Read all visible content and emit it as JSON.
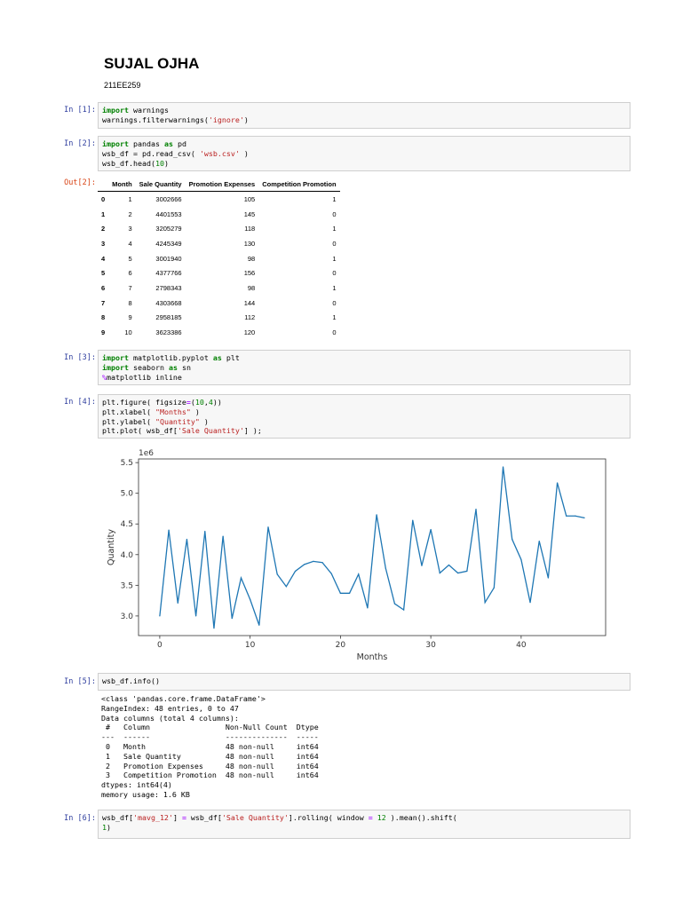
{
  "title": "SUJAL OJHA",
  "subtitle": "211EE259",
  "cells": [
    {
      "prompt": "In [1]:",
      "lines": [
        [
          [
            "import",
            "kw"
          ],
          [
            " warnings",
            ""
          ]
        ],
        [
          [
            "warnings.filterwarnings(",
            ""
          ],
          [
            "'ignore'",
            "str"
          ],
          [
            ")",
            ""
          ]
        ]
      ]
    },
    {
      "prompt": "In [2]:",
      "lines": [
        [
          [
            "import",
            "kw"
          ],
          [
            " pandas ",
            ""
          ],
          [
            "as",
            "kw"
          ],
          [
            " pd",
            ""
          ]
        ],
        [
          [
            "wsb_df = pd.read_csv( ",
            ""
          ],
          [
            "'wsb.csv'",
            "str"
          ],
          [
            " )",
            ""
          ]
        ],
        [
          [
            "wsb_df.head(",
            ""
          ],
          [
            "10",
            "num"
          ],
          [
            ")",
            ""
          ]
        ]
      ]
    },
    {
      "prompt": "In [3]:",
      "lines": [
        [
          [
            "import",
            "kw"
          ],
          [
            " matplotlib.pyplot ",
            ""
          ],
          [
            "as",
            "kw"
          ],
          [
            " plt",
            ""
          ]
        ],
        [
          [
            "import",
            "kw"
          ],
          [
            " seaborn ",
            ""
          ],
          [
            "as",
            "kw"
          ],
          [
            " sn",
            ""
          ]
        ],
        [
          [
            "%",
            "mag"
          ],
          [
            "matplotlib inline",
            ""
          ]
        ]
      ]
    },
    {
      "prompt": "In [4]:",
      "lines": [
        [
          [
            "plt.figure( figsize",
            ""
          ],
          [
            "=",
            "mag"
          ],
          [
            "(",
            ""
          ],
          [
            "10",
            "num"
          ],
          [
            ",",
            ""
          ],
          [
            "4",
            "num"
          ],
          [
            "))",
            ""
          ]
        ],
        [
          [
            "plt.xlabel( ",
            ""
          ],
          [
            "\"Months\"",
            "str"
          ],
          [
            " )",
            ""
          ]
        ],
        [
          [
            "plt.ylabel( ",
            ""
          ],
          [
            "\"Quantity\"",
            "str"
          ],
          [
            " )",
            ""
          ]
        ],
        [
          [
            "plt.plot( wsb_df[",
            ""
          ],
          [
            "'Sale Quantity'",
            "str"
          ],
          [
            "] );",
            ""
          ]
        ]
      ]
    },
    {
      "prompt": "In [5]:",
      "lines": [
        [
          [
            "wsb_df.info()",
            ""
          ]
        ]
      ]
    },
    {
      "prompt": "In [6]:",
      "lines": [
        [
          [
            "wsb_df[",
            ""
          ],
          [
            "'mavg_12'",
            "str"
          ],
          [
            "] ",
            ""
          ],
          [
            "=",
            "mag"
          ],
          [
            " wsb_df[",
            ""
          ],
          [
            "'Sale Quantity'",
            "str"
          ],
          [
            "].rolling( window ",
            ""
          ],
          [
            "=",
            "mag"
          ],
          [
            " ",
            ""
          ],
          [
            "12",
            "num"
          ],
          [
            " ).mean().shift(",
            ""
          ]
        ],
        [
          [
            "1",
            "num"
          ],
          [
            ")",
            ""
          ]
        ]
      ]
    }
  ],
  "out2": {
    "prompt": "Out[2]:",
    "columns": [
      "",
      "Month",
      "Sale Quantity",
      "Promotion Expenses",
      "Competition Promotion"
    ],
    "rows": [
      [
        "0",
        "1",
        "3002666",
        "105",
        "1"
      ],
      [
        "1",
        "2",
        "4401553",
        "145",
        "0"
      ],
      [
        "2",
        "3",
        "3205279",
        "118",
        "1"
      ],
      [
        "3",
        "4",
        "4245349",
        "130",
        "0"
      ],
      [
        "4",
        "5",
        "3001940",
        "98",
        "1"
      ],
      [
        "5",
        "6",
        "4377766",
        "156",
        "0"
      ],
      [
        "6",
        "7",
        "2798343",
        "98",
        "1"
      ],
      [
        "7",
        "8",
        "4303668",
        "144",
        "0"
      ],
      [
        "8",
        "9",
        "2958185",
        "112",
        "1"
      ],
      [
        "9",
        "10",
        "3623386",
        "120",
        "0"
      ]
    ]
  },
  "info_output": "<class 'pandas.core.frame.DataFrame'>\nRangeIndex: 48 entries, 0 to 47\nData columns (total 4 columns):\n #   Column                 Non-Null Count  Dtype\n---  ------                 --------------  -----\n 0   Month                  48 non-null     int64\n 1   Sale Quantity          48 non-null     int64\n 2   Promotion Expenses     48 non-null     int64\n 3   Competition Promotion  48 non-null     int64\ndtypes: int64(4)\nmemory usage: 1.6 KB",
  "chart_data": {
    "type": "line",
    "xlabel": "Months",
    "ylabel": "Quantity",
    "offset_label": "1e6",
    "xlim": [
      -2.35,
      49.35
    ],
    "ylim": [
      2.68,
      5.56
    ],
    "xticks": [
      0,
      10,
      20,
      30,
      40
    ],
    "yticks": [
      3.0,
      3.5,
      4.0,
      4.5,
      5.0,
      5.5
    ],
    "ytick_labels": [
      "3.0",
      "3.5",
      "4.0",
      "4.5",
      "5.0",
      "5.5"
    ],
    "color": "#1f77b4",
    "x": [
      0,
      1,
      2,
      3,
      4,
      5,
      6,
      7,
      8,
      9,
      10,
      11,
      12,
      13,
      14,
      15,
      16,
      17,
      18,
      19,
      20,
      21,
      22,
      23,
      24,
      25,
      26,
      27,
      28,
      29,
      30,
      31,
      32,
      33,
      34,
      35,
      36,
      37,
      38,
      39,
      40,
      41,
      42,
      43,
      44,
      45,
      46,
      47
    ],
    "y": [
      3.0,
      4.4,
      3.21,
      4.25,
      3.0,
      4.38,
      2.8,
      4.3,
      2.96,
      3.62,
      3.27,
      2.85,
      4.45,
      3.68,
      3.48,
      3.73,
      3.84,
      3.89,
      3.87,
      3.69,
      3.37,
      3.37,
      3.68,
      3.13,
      4.65,
      3.78,
      3.2,
      3.1,
      4.56,
      3.82,
      4.41,
      3.7,
      3.83,
      3.7,
      3.73,
      4.74,
      3.22,
      3.46,
      5.43,
      4.25,
      3.92,
      3.22,
      4.22,
      3.62,
      5.17,
      4.63,
      4.63,
      4.6
    ]
  }
}
